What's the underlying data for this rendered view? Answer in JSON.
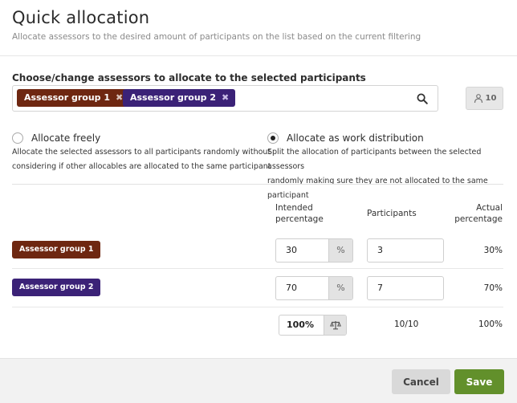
{
  "header": {
    "title": "Quick allocation",
    "subtitle": "Allocate assessors to the desired amount of participants on the list based on the current filtering"
  },
  "assessors": {
    "label": "Choose/change assessors to allocate to the selected participants",
    "tags": [
      {
        "label": "Assessor group 1",
        "remove": "✖",
        "color": "#6e2711"
      },
      {
        "label": "Assessor group 2",
        "remove": "✖",
        "color": "#3b2277"
      }
    ],
    "count_button": "10"
  },
  "modes": {
    "free": {
      "label": "Allocate freely",
      "desc1": "Allocate the selected assessors to all participants randomly without",
      "desc2": "considering if other allocables are allocated to the same participant",
      "selected": false
    },
    "distribution": {
      "label": "Allocate as work distribution",
      "desc1": "Split the allocation of participants between the selected assessors",
      "desc2": "randomly making sure they are not allocated to the same participant",
      "selected": true
    }
  },
  "table": {
    "col_intended_1": "Intended",
    "col_intended_2": "percentage",
    "col_participants": "Participants",
    "col_actual_1": "Actual",
    "col_actual_2": "percentage",
    "rows": [
      {
        "name": "Assessor group 1",
        "intended": "30",
        "unit": "%",
        "participants": "3",
        "actual": "30%"
      },
      {
        "name": "Assessor group 2",
        "intended": "70",
        "unit": "%",
        "participants": "7",
        "actual": "70%"
      }
    ],
    "total": {
      "intended": "100%",
      "participants": "10/10",
      "actual": "100%"
    }
  },
  "footer": {
    "cancel": "Cancel",
    "save": "Save"
  },
  "colors": {
    "save": "#62902b",
    "group1": "#6e2711",
    "group2": "#3b2277"
  }
}
